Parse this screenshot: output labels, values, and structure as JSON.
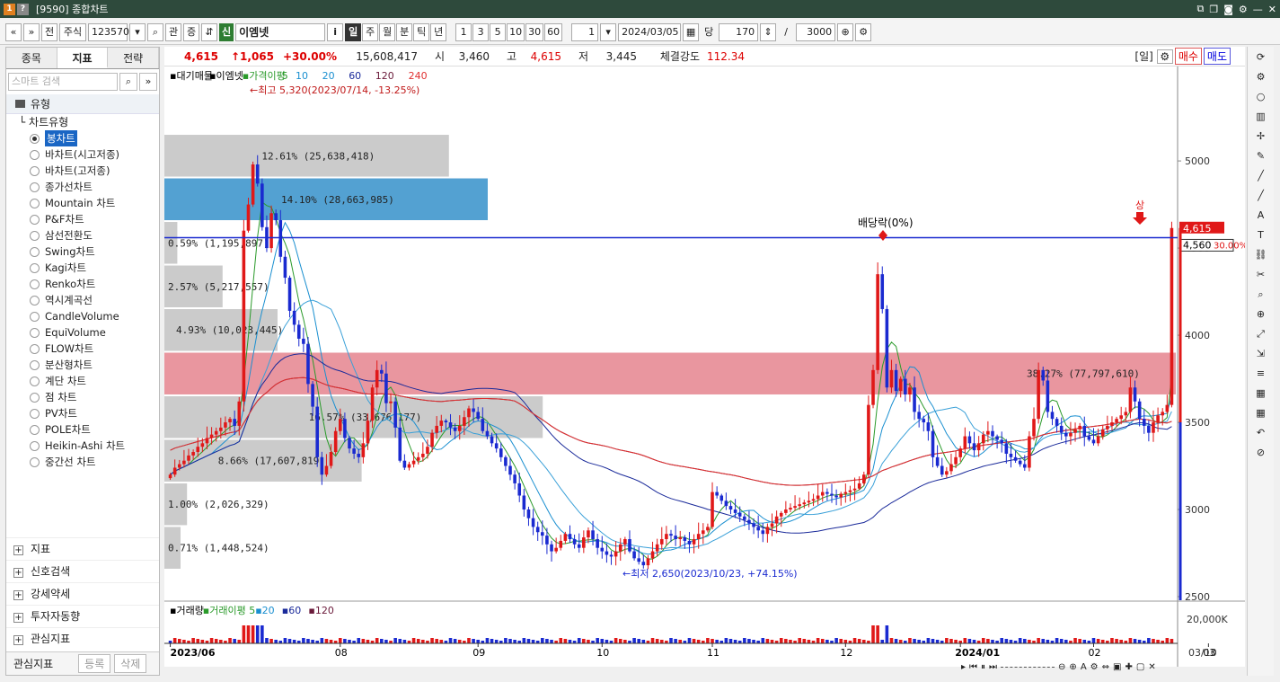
{
  "window": {
    "title": "[9590] 종합차트",
    "left_icons": [
      "1",
      "?"
    ],
    "right_icons": [
      "layout-icon",
      "copy-icon",
      "camera-icon",
      "gear-icon",
      "minimize-icon",
      "close-icon"
    ]
  },
  "toolbar": {
    "nav": [
      "«",
      "»"
    ],
    "prev": "전",
    "market": "주식",
    "code": "123570",
    "search_glyph": "⌕",
    "btn_gwan": "관",
    "btn_jeung": "증",
    "sin": "신",
    "stock_name": "이엠넷",
    "info": "i",
    "periods": [
      "일",
      "주",
      "월",
      "분",
      "틱",
      "년"
    ],
    "period_selected": "일",
    "counts": [
      "1",
      "3",
      "5",
      "10",
      "30",
      "60"
    ],
    "unit": "1",
    "date": "2024/03/05",
    "dang": "당",
    "bars": "170",
    "slash": "/",
    "total": "3000"
  },
  "left_panel": {
    "tabs": [
      "종목",
      "지표",
      "전략"
    ],
    "active_tab": "지표",
    "search_placeholder": "스마트 검색",
    "folder": "유형",
    "subfolder": "차트유형",
    "chart_types": [
      "봉차트",
      "바차트(시고저종)",
      "바차트(고저종)",
      "종가선차트",
      "Mountain 차트",
      "P&F차트",
      "삼선전환도",
      "Swing차트",
      "Kagi차트",
      "Renko차트",
      "역시계곡선",
      "CandleVolume",
      "EquiVolume",
      "FLOW차트",
      "분산형차트",
      "계단 차트",
      "점 차트",
      "PV차트",
      "POLE차트",
      "Heikin-Ashi 차트",
      "중간선 차트"
    ],
    "selected_type": "봉차트",
    "bottom_items": [
      "지표",
      "신호검색",
      "강세약세",
      "투자자동향",
      "관심지표"
    ],
    "footer": {
      "label": "관심지표",
      "register": "등록",
      "delete": "삭제"
    }
  },
  "infobar": {
    "price": "4,615",
    "change": "↑1,065",
    "change_pct": "+30.00%",
    "volume": "15,608,417",
    "open_label": "시",
    "open": "3,460",
    "high_label": "고",
    "high": "4,615",
    "low_label": "저",
    "low": "3,445",
    "strength_label": "체결강도",
    "strength": "112.34",
    "period_tag": "[일]",
    "buy": "매수",
    "sell": "매도"
  },
  "chart_data": {
    "type": "candlestick",
    "legend": {
      "vp": "대기매물",
      "name": "이엠넷",
      "ma_label": "가격이평",
      "ma": [
        {
          "p": "5",
          "color": "#2a9a2a"
        },
        {
          "p": "10",
          "color": "#1a8fd0"
        },
        {
          "p": "20",
          "color": "#1a8fd0"
        },
        {
          "p": "60",
          "color": "#1a2a9a"
        },
        {
          "p": "120",
          "color": "#6a1a3a"
        },
        {
          "p": "240",
          "color": "#e03030"
        }
      ]
    },
    "y_ticks": [
      5000,
      4500,
      4000,
      3500,
      3000,
      2500
    ],
    "ylim": [
      2500,
      5480
    ],
    "x_labels": [
      "2023/06",
      "08",
      "09",
      "10",
      "11",
      "12",
      "2024/01",
      "02",
      "03"
    ],
    "x_label_idx": [
      0,
      37,
      67,
      94,
      118,
      147,
      172,
      201,
      226
    ],
    "annotations": {
      "high": "←최고 5,320(2023/07/14, -13.25%)",
      "low": "←최저 2,650(2023/10/23, +74.15%)",
      "dividend": "배당락(0%)",
      "limit_up": "상"
    },
    "current_price": "4,615",
    "current_pct": "30.00%",
    "hline": "4,560",
    "volume_profile": [
      {
        "lo": 4905,
        "hi": 5155,
        "pct": "12.61%",
        "vol": "(25,638,418)",
        "w": 0.88
      },
      {
        "lo": 4655,
        "hi": 4905,
        "pct": "14.10%",
        "vol": "(28,663,985)",
        "w": 1.0,
        "hl": "blue"
      },
      {
        "lo": 4405,
        "hi": 4655,
        "pct": "0.59%",
        "vol": "(1,195,897)",
        "w": 0.04
      },
      {
        "lo": 4155,
        "hi": 4405,
        "pct": "2.57%",
        "vol": "(5,217,557)",
        "w": 0.18
      },
      {
        "lo": 3905,
        "hi": 4155,
        "pct": "4.93%",
        "vol": "(10,023,445)",
        "w": 0.35
      },
      {
        "lo": 3655,
        "hi": 3905,
        "pct": "38.27%",
        "vol": "(77,797,610)",
        "w": 2.7,
        "hl": "red"
      },
      {
        "lo": 3405,
        "hi": 3655,
        "pct": "16.57%",
        "vol": "(33,676,177)",
        "w": 1.17
      },
      {
        "lo": 3155,
        "hi": 3405,
        "pct": "8.66%",
        "vol": "(17,607,819)",
        "w": 0.61
      },
      {
        "lo": 2905,
        "hi": 3155,
        "pct": "1.00%",
        "vol": "(2,026,329)",
        "w": 0.07
      },
      {
        "lo": 2655,
        "hi": 2905,
        "pct": "0.71%",
        "vol": "(1,448,524)",
        "w": 0.05
      }
    ],
    "closes": [
      3200,
      3240,
      3260,
      3280,
      3310,
      3330,
      3360,
      3380,
      3410,
      3430,
      3450,
      3470,
      3500,
      3520,
      3480,
      3620,
      4600,
      4750,
      4980,
      4870,
      4620,
      4500,
      4700,
      4660,
      4450,
      4330,
      4140,
      4060,
      3980,
      3950,
      3720,
      3590,
      3300,
      3200,
      3250,
      3330,
      3450,
      3520,
      3410,
      3350,
      3320,
      3300,
      3380,
      3510,
      3700,
      3800,
      3780,
      3610,
      3620,
      3470,
      3280,
      3240,
      3260,
      3280,
      3300,
      3320,
      3360,
      3440,
      3480,
      3510,
      3500,
      3470,
      3450,
      3480,
      3530,
      3580,
      3560,
      3520,
      3450,
      3420,
      3380,
      3350,
      3300,
      3250,
      3200,
      3150,
      3080,
      3000,
      2950,
      2900,
      2870,
      2850,
      2800,
      2760,
      2780,
      2820,
      2860,
      2830,
      2800,
      2780,
      2840,
      2880,
      2830,
      2780,
      2760,
      2740,
      2730,
      2760,
      2800,
      2830,
      2760,
      2720,
      2700,
      2680,
      2720,
      2760,
      2800,
      2830,
      2860,
      2850,
      2830,
      2840,
      2820,
      2800,
      2830,
      2860,
      2880,
      2900,
      3100,
      3080,
      3050,
      3020,
      3000,
      2980,
      2960,
      2940,
      2920,
      2900,
      2880,
      2860,
      2900,
      2920,
      2960,
      2980,
      3000,
      3010,
      3020,
      3030,
      3040,
      3050,
      3060,
      3080,
      3100,
      3090,
      3080,
      3070,
      3090,
      3100,
      3110,
      3120,
      3150,
      3200,
      3600,
      3800,
      4350,
      4150,
      3700,
      3800,
      3680,
      3750,
      3660,
      3700,
      3560,
      3520,
      3500,
      3450,
      3300,
      3250,
      3200,
      3220,
      3260,
      3300,
      3350,
      3420,
      3380,
      3340,
      3380,
      3430,
      3450,
      3420,
      3400,
      3380,
      3320,
      3300,
      3280,
      3260,
      3240,
      3420,
      3520,
      3800,
      3740,
      3560,
      3520,
      3480,
      3440,
      3420,
      3440,
      3460,
      3480,
      3420,
      3400,
      3380,
      3420,
      3460,
      3480,
      3500,
      3520,
      3540,
      3560,
      3700,
      3620,
      3520,
      3480,
      3440,
      3500,
      3540,
      3560,
      3600,
      4615
    ],
    "volume_axis": "20,000K",
    "volume_legend": {
      "label": "거래량",
      "ma_label": "거래이평",
      "periods": [
        "5",
        "20",
        "60",
        "120"
      ]
    },
    "date_right": "03/10"
  },
  "rightbar": [
    "refresh-icon",
    "gear-icon",
    "circle-icon",
    "bar-icon",
    "cross-icon",
    "pen-icon",
    "line-icon",
    "line-icon",
    "auto-icon",
    "text-icon",
    "link-icon",
    "cut-icon",
    "zoom-icon",
    "zoom-in-icon",
    "scale-icon",
    "measure-icon",
    "fib-icon",
    "grid-icon",
    "grid-icon",
    "undo-icon",
    "clear-icon"
  ]
}
